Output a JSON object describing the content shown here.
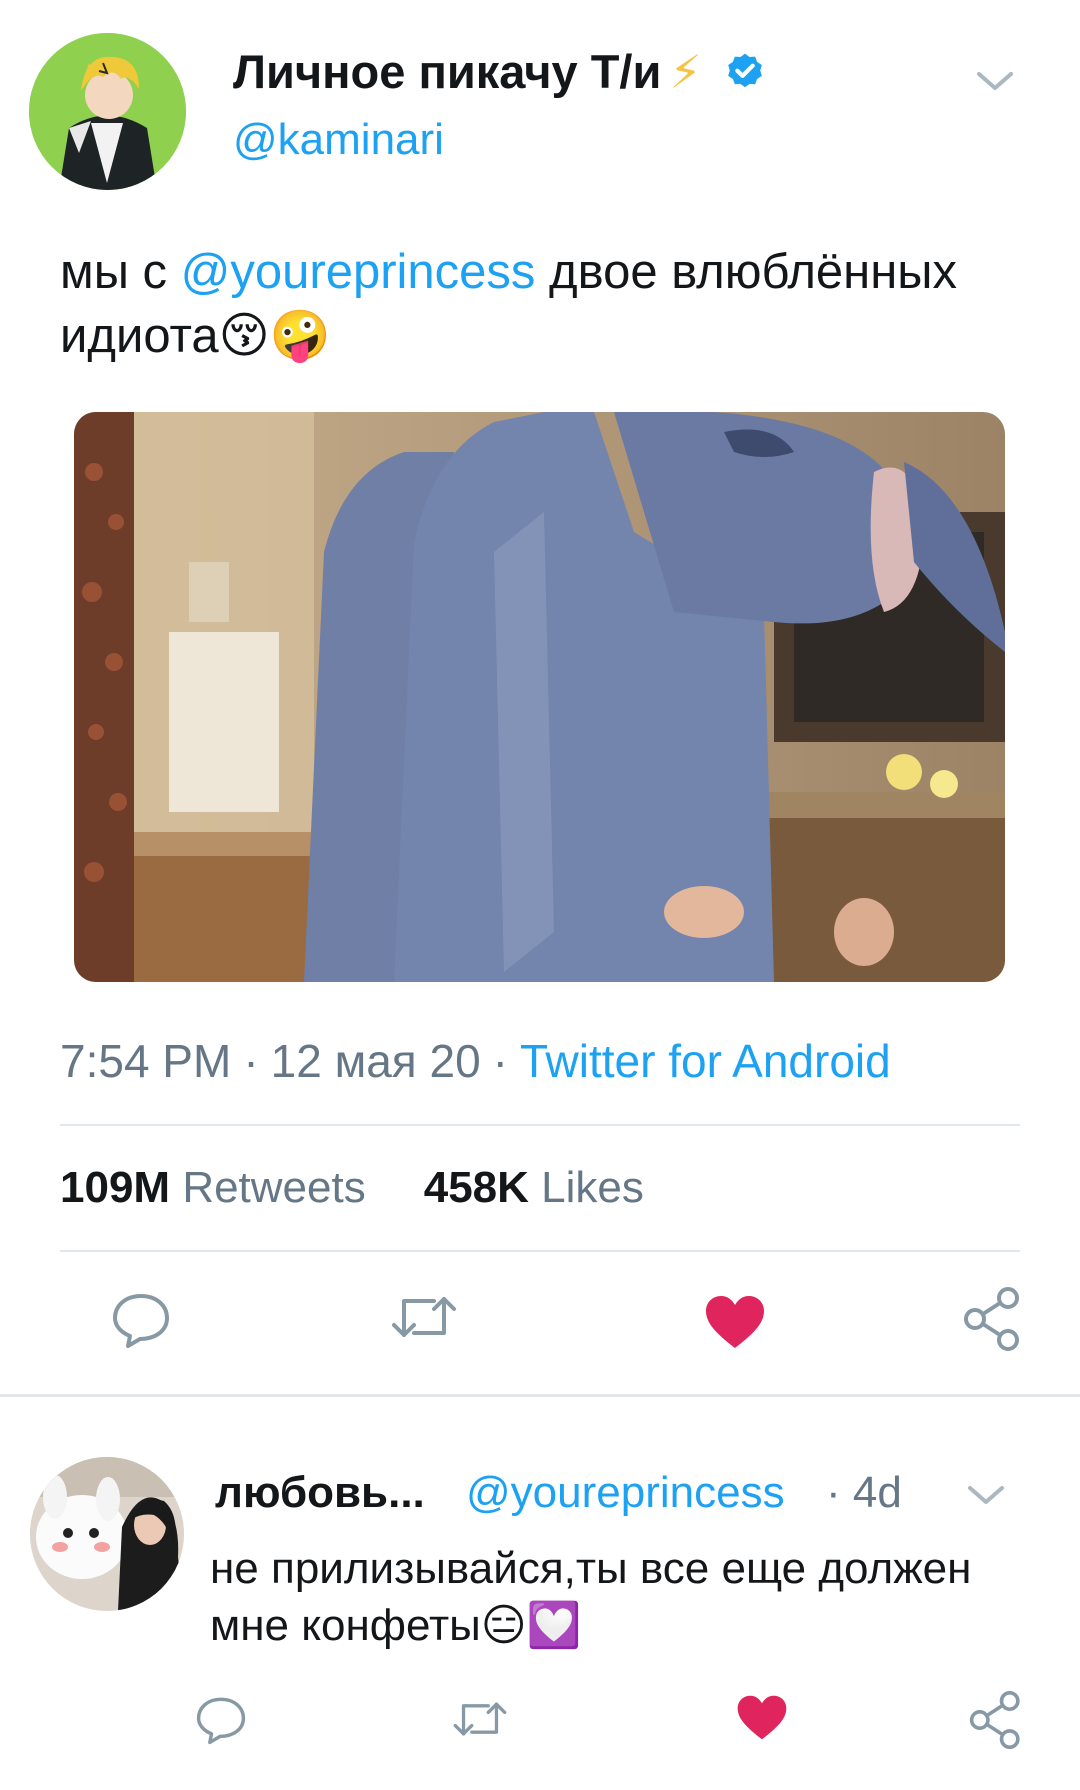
{
  "tweet": {
    "author_name": "Личное пикачу Т/и",
    "author_name_icon": "lightning-bolt",
    "bolt_glyph": "⚡",
    "verified_icon": "verified-badge",
    "handle": "@kaminari",
    "text_prefix": "мы с ",
    "mention": "@youreprincess",
    "text_suffix": " двое влюблённых идиота",
    "emojis": "😚🤪",
    "time": "7:54 PM",
    "date": "12 мая 20",
    "source": "Twitter for Android",
    "separator": "·",
    "retweets_count": "109M",
    "retweets_label": "Retweets",
    "likes_count": "458K",
    "likes_label": "Likes",
    "actions": [
      "reply-icon",
      "retweet-icon",
      "heart-icon",
      "share-icon"
    ]
  },
  "reply": {
    "author_name": "любовь...",
    "handle": "@youreprincess",
    "time": "· 4d",
    "text": "не прилизывайся,ты все еще должен мне конфеты",
    "emojis": "😑💟",
    "actions": [
      "reply-icon",
      "retweet-icon",
      "heart-icon",
      "share-icon"
    ]
  },
  "colors": {
    "accent": "#1da1f2",
    "like": "#e0245e",
    "muted": "#657786",
    "divider": "#e1e8ed"
  }
}
